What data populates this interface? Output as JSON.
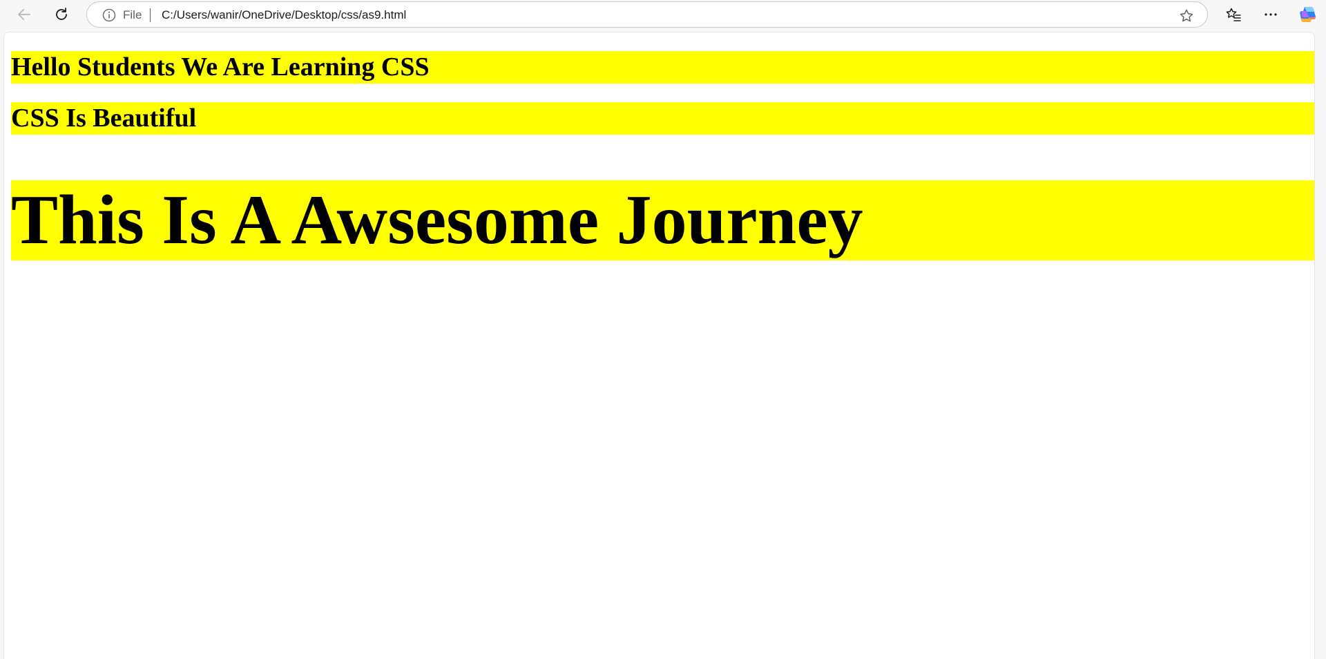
{
  "browser": {
    "address_bar": {
      "scheme_label": "File",
      "url": "C:/Users/wanir/OneDrive/Desktop/css/as9.html"
    },
    "icons": {
      "back": "back-arrow-icon",
      "reload": "reload-icon",
      "info": "info-icon",
      "favorite": "star-icon",
      "favorites_list": "favorites-icon",
      "more": "more-options-icon",
      "copilot": "copilot-icon"
    }
  },
  "page": {
    "headings": [
      "Hello Students We Are Learning CSS",
      "CSS Is Beautiful",
      "This Is A Awsesome Journey"
    ],
    "heading_background": "#ffff00",
    "heading_color": "#000000"
  }
}
